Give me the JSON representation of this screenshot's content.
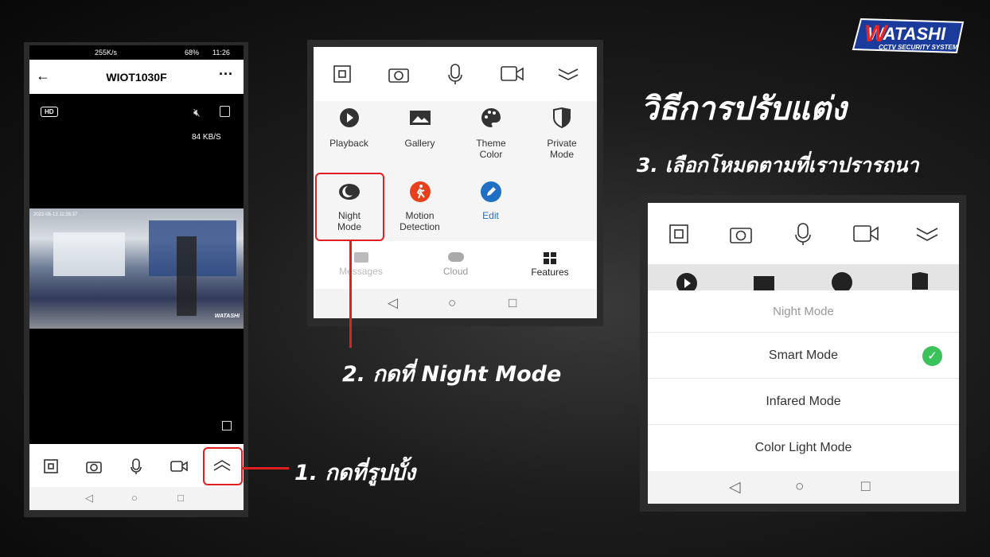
{
  "logo": {
    "brand": "WATASHI",
    "tagline": "CCTV SECURITY SYSTEM"
  },
  "title": "วิธีการปรับแต่ง",
  "steps": {
    "step1": "1. กดที่รูปบั้ง",
    "step2": "2. กดที่ Night Mode",
    "step3": "3. เลือกโหมดตามที่เราปรารถนา"
  },
  "phone": {
    "status": {
      "speed": "255K/s",
      "battery": "68%",
      "time": "11:26"
    },
    "header_title": "WIOT1030F",
    "hd_badge": "HD",
    "bitrate": "84 KB/S",
    "timestamp": "2022-05-13 11:26:37",
    "watermark": "WATASHI"
  },
  "menu": {
    "items": [
      {
        "label": "Playback",
        "icon": "play-icon"
      },
      {
        "label": "Gallery",
        "icon": "image-icon"
      },
      {
        "label": "Theme Color",
        "icon": "palette-icon"
      },
      {
        "label": "Private Mode",
        "icon": "shield-icon"
      },
      {
        "label": "Night Mode",
        "icon": "moon-icon"
      },
      {
        "label": "Motion Detection",
        "icon": "walking-icon"
      },
      {
        "label": "Edit",
        "icon": "pencil-icon"
      }
    ],
    "tabs": [
      {
        "label": "Messages"
      },
      {
        "label": "Cloud"
      },
      {
        "label": "Features"
      }
    ]
  },
  "night_mode": {
    "title": "Night Mode",
    "options": [
      {
        "label": "Smart Mode",
        "selected": true
      },
      {
        "label": "Infared Mode",
        "selected": false
      },
      {
        "label": "Color Light Mode",
        "selected": false
      }
    ]
  },
  "colors": {
    "highlight": "#e02020",
    "edit": "#1f6fc5",
    "motion": "#e8401c",
    "check": "#3cc25a"
  }
}
